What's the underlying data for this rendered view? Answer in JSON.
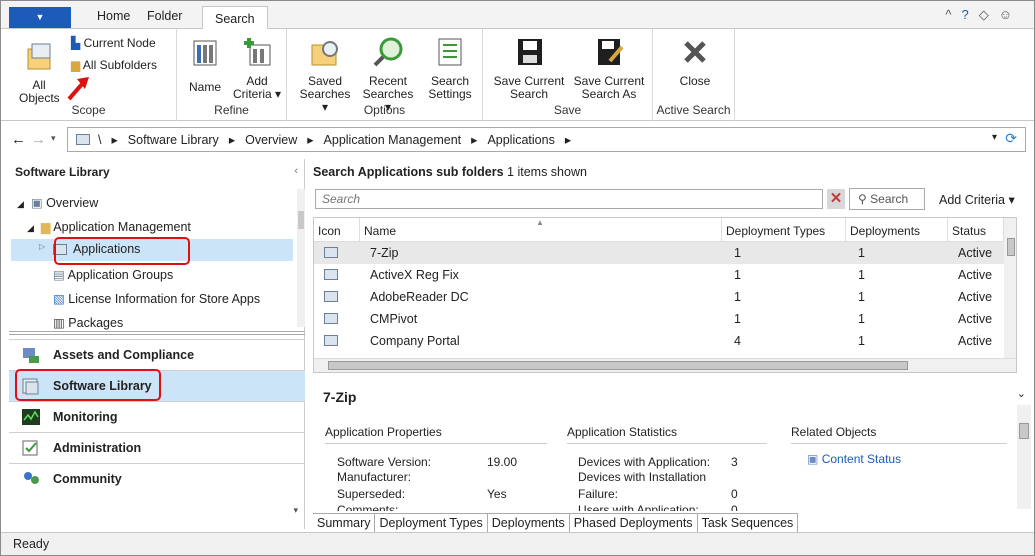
{
  "ribbon_tabs": {
    "home": "Home",
    "folder": "Folder",
    "search": "Search"
  },
  "ribbon": {
    "scope": {
      "title": "Scope",
      "current_node": "Current Node",
      "all_subfolders": "All Subfolders",
      "all_objects_1": "All",
      "all_objects_2": "Objects"
    },
    "refine": {
      "title": "Refine",
      "name": "Name",
      "add_criteria_1": "Add",
      "add_criteria_2": "Criteria ▾"
    },
    "options": {
      "title": "Options",
      "saved_1": "Saved",
      "saved_2": "Searches ▾",
      "recent_1": "Recent",
      "recent_2": "Searches ▾",
      "settings_1": "Search",
      "settings_2": "Settings"
    },
    "save": {
      "title": "Save",
      "save_current_1": "Save Current",
      "save_current_2": "Search",
      "save_as_1": "Save Current",
      "save_as_2": "Search As"
    },
    "active": {
      "title": "Active Search",
      "close": "Close"
    }
  },
  "address": {
    "root": "\\",
    "crumbs": [
      "Software Library",
      "Overview",
      "Application Management",
      "Applications"
    ],
    "sep": "▸"
  },
  "nav": {
    "title": "Software Library",
    "tree": {
      "overview": "Overview",
      "app_mgmt": "Application Management",
      "applications": "Applications",
      "app_groups": "Application Groups",
      "license": "License Information for Store Apps",
      "packages": "Packages"
    },
    "workspaces": [
      "Assets and Compliance",
      "Software Library",
      "Monitoring",
      "Administration",
      "Community"
    ]
  },
  "list": {
    "header_bold": "Search Applications sub folders",
    "header_count": " 1 items shown",
    "search_placeholder": "Search",
    "search_button": "Search",
    "add_criteria": "Add Criteria ▾",
    "columns": [
      "Icon",
      "Name",
      "Deployment Types",
      "Deployments",
      "Status"
    ],
    "rows": [
      {
        "name": "7-Zip",
        "dt": "1",
        "dep": "1",
        "status": "Active"
      },
      {
        "name": "ActiveX Reg Fix",
        "dt": "1",
        "dep": "1",
        "status": "Active"
      },
      {
        "name": "AdobeReader DC",
        "dt": "1",
        "dep": "1",
        "status": "Active"
      },
      {
        "name": "CMPivot",
        "dt": "1",
        "dep": "1",
        "status": "Active"
      },
      {
        "name": "Company Portal",
        "dt": "4",
        "dep": "1",
        "status": "Active"
      }
    ]
  },
  "detail": {
    "title": "7-Zip",
    "props_title": "Application Properties",
    "stats_title": "Application Statistics",
    "related_title": "Related Objects",
    "software_version_label": "Software Version:",
    "software_version": "19.00",
    "manufacturer_label": "Manufacturer:",
    "superseded_label": "Superseded:",
    "superseded": "Yes",
    "comments_label": "Comments:",
    "dev_with_app_label": "Devices with Application:",
    "dev_with_app": "3",
    "dev_install_label": "Devices with Installation",
    "failure_label": "Failure:",
    "failure": "0",
    "users_label": "Users with Application:",
    "users": "0",
    "content_status": "Content Status",
    "tabs": [
      "Summary",
      "Deployment Types",
      "Deployments",
      "Phased Deployments",
      "Task Sequences"
    ]
  },
  "status": "Ready",
  "colors": {
    "accent": "#1c5bb8",
    "highlight": "#e01010",
    "selected": "#cce4f7"
  }
}
